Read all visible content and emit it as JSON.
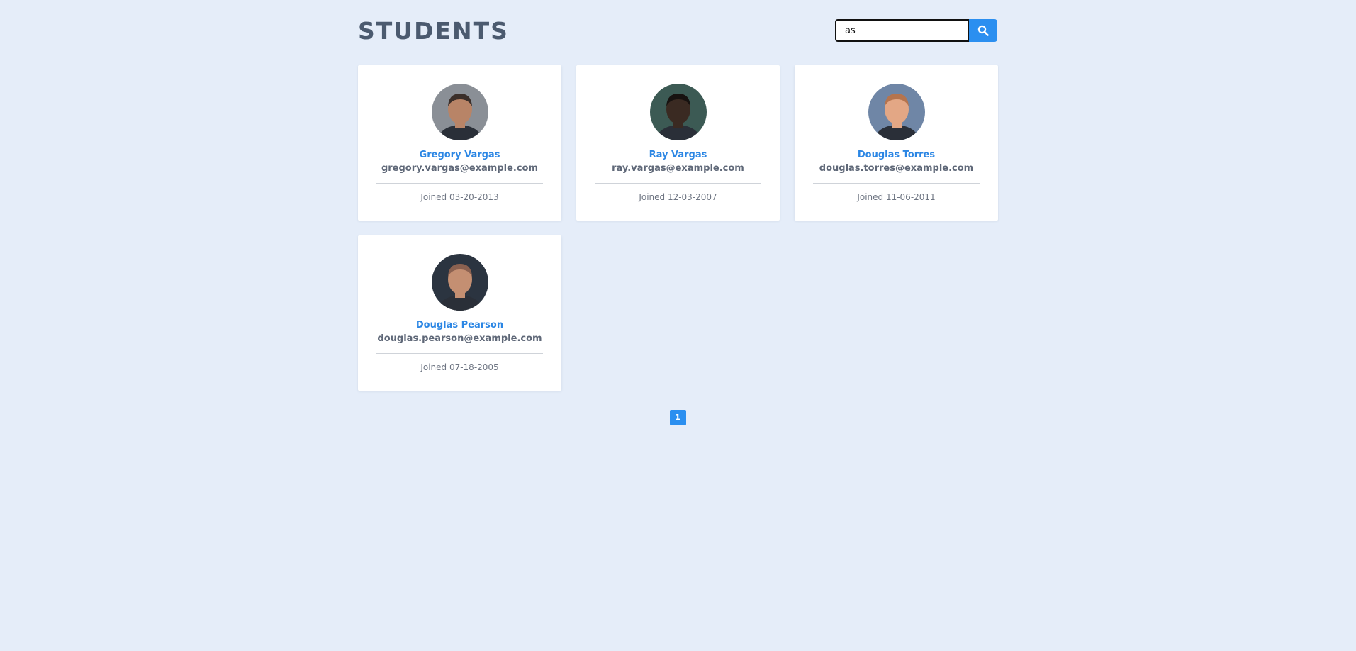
{
  "header": {
    "title": "STUDENTS"
  },
  "search": {
    "value": "as",
    "icon": "search-icon"
  },
  "students": [
    {
      "name": "Gregory Vargas",
      "email": "gregory.vargas@example.com",
      "joined": "Joined 03-20-2013",
      "avatar_colors": {
        "bg": "#8a8f96",
        "skin": "#b88467",
        "hair": "#3b2f2a"
      }
    },
    {
      "name": "Ray Vargas",
      "email": "ray.vargas@example.com",
      "joined": "Joined 12-03-2007",
      "avatar_colors": {
        "bg": "#3c5a54",
        "skin": "#3a2a22",
        "hair": "#171210"
      }
    },
    {
      "name": "Douglas Torres",
      "email": "douglas.torres@example.com",
      "joined": "Joined 11-06-2011",
      "avatar_colors": {
        "bg": "#6f86a6",
        "skin": "#e3a785",
        "hair": "#b5744e"
      }
    },
    {
      "name": "Douglas Pearson",
      "email": "douglas.pearson@example.com",
      "joined": "Joined 07-18-2005",
      "avatar_colors": {
        "bg": "#2b3440",
        "skin": "#c48f72",
        "hair": "#8b6150"
      }
    }
  ],
  "pagination": {
    "pages": [
      "1"
    ],
    "current": "1"
  },
  "colors": {
    "background": "#e5edf9",
    "accent": "#2b8ff0",
    "name": "#2b86e4",
    "title": "#4b5a6f"
  }
}
